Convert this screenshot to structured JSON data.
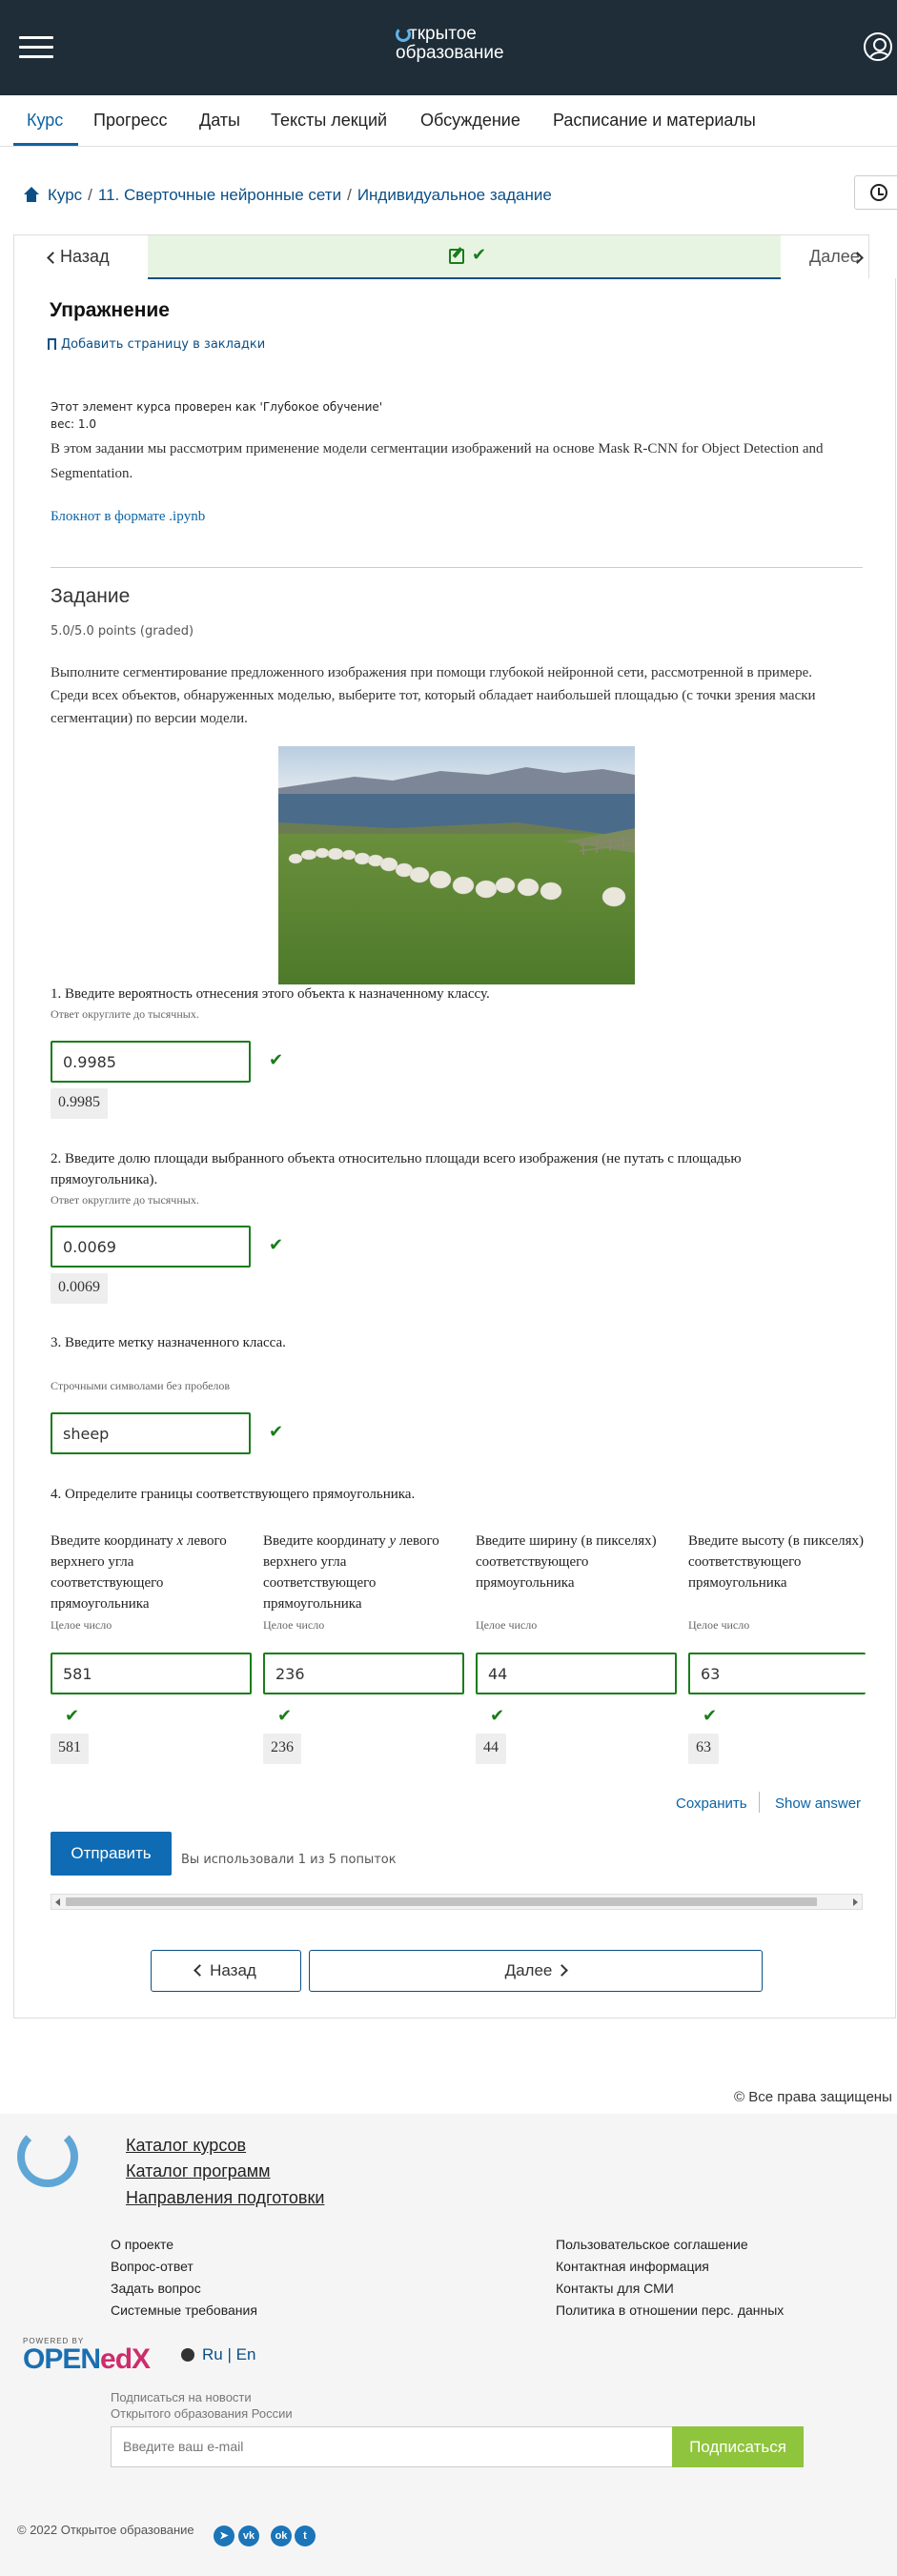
{
  "header": {
    "logo_line1": "ткрытое",
    "logo_line2": "образование"
  },
  "course_nav": {
    "tabs": [
      "Курс",
      "Прогресс",
      "Даты",
      "Тексты лекций",
      "Обсуждение",
      "Расписание и материалы"
    ],
    "active": "Курс"
  },
  "breadcrumb": {
    "items": [
      "Курс",
      "11. Сверточные нейронные сети",
      "Индивидуальное задание"
    ]
  },
  "sequence": {
    "prev_label": "Назад",
    "next_label": "Далее"
  },
  "unit": {
    "title": "Упражнение",
    "bookmark_label": "Добавить страницу в закладки",
    "meta_line1": "Этот элемент курса проверен как 'Глубокое обучение'",
    "meta_line2": "вес: 1.0",
    "intro": "В этом задании мы рассмотрим применение модели сегментации изображений на основе Mask R-CNN for Object Detection and Segmentation.",
    "notebook_link": "Блокнот в формате .ipynb"
  },
  "problem": {
    "title": "Задание",
    "points": "5.0/5.0 points (graded)",
    "description": "Выполните сегментирование предложенного изображения при помощи глубокой нейронной сети, рассмотренной в примере. Среди всех объектов, обнаруженных моделью, выберите тот, который обладает наибольшей площадью (с точки зрения маски сегментации) по версии модели.",
    "q1": {
      "text": "1. Введите вероятность отнесения этого объекта к назначенному классу.",
      "hint": "Ответ округлите до тысячных.",
      "value": "0.9985",
      "answer": "0.9985"
    },
    "q2": {
      "text": "2. Введите долю площади выбранного объекта относительно площади всего изображения (не путать с площадью прямоугольника).",
      "hint": "Ответ округлите до тысячных.",
      "value": "0.0069",
      "answer": "0.0069"
    },
    "q3": {
      "text": "3. Введите метку назначенного класса.",
      "hint": "Строчными символами без пробелов",
      "value": "sheep"
    },
    "q4": {
      "text": "4. Определите границы соответствующего прямоугольника.",
      "fields": [
        {
          "label_a": "Введите координату ",
          "label_var": "x",
          "label_b": " левого верхнего угла соответствующего прямоугольника",
          "hint": "Целое число",
          "value": "581",
          "answer": "581"
        },
        {
          "label_a": "Введите координату ",
          "label_var": "y",
          "label_b": " левого верхнего угла соответствующего прямоугольника",
          "hint": "Целое число",
          "value": "236",
          "answer": "236"
        },
        {
          "label_a": "Введите ширину (в пикселях) соответствующего прямоугольника",
          "label_var": "",
          "label_b": "",
          "hint": "Целое число",
          "value": "44",
          "answer": "44"
        },
        {
          "label_a": "Введите высоту (в пикселях) соответствующего прямоугольника",
          "label_var": "",
          "label_b": "",
          "hint": "Целое число",
          "value": "63",
          "answer": "63"
        }
      ]
    },
    "save_label": "Сохранить",
    "show_answer_label": "Show answer",
    "submit_label": "Отправить",
    "attempts": "Вы использовали 1 из 5 попыток"
  },
  "bottom_nav": {
    "prev_label": "Назад",
    "next_label": "Далее"
  },
  "footer": {
    "rights": "© Все права защищены",
    "main_links": [
      "Каталог курсов",
      "Каталог программ",
      "Направления подготовки"
    ],
    "links_left": [
      "О проекте",
      "Вопрос-ответ",
      "Задать вопрос",
      "Системные требования"
    ],
    "links_right": [
      "Пользовательское соглашение",
      "Контактная информация",
      "Контакты для СМИ",
      "Политика в отношении перс. данных"
    ],
    "powered_by": "POWERED BY",
    "openedx_a": "OPEN",
    "openedx_b": "edX",
    "lang_ru": "Ru",
    "lang_sep": "|",
    "lang_en": "En",
    "news_line1": "Подписаться на новости",
    "news_line2": "Открытого образования России",
    "email_placeholder": "Введите ваш e-mail",
    "subscribe_label": "Подписаться",
    "copyright": "© 2022 Открытое образование"
  },
  "colors": {
    "topbar": "#1e2d38",
    "accent": "#0b63a5",
    "correct": "#1a7d1a",
    "subscribe": "#8fc43d"
  }
}
